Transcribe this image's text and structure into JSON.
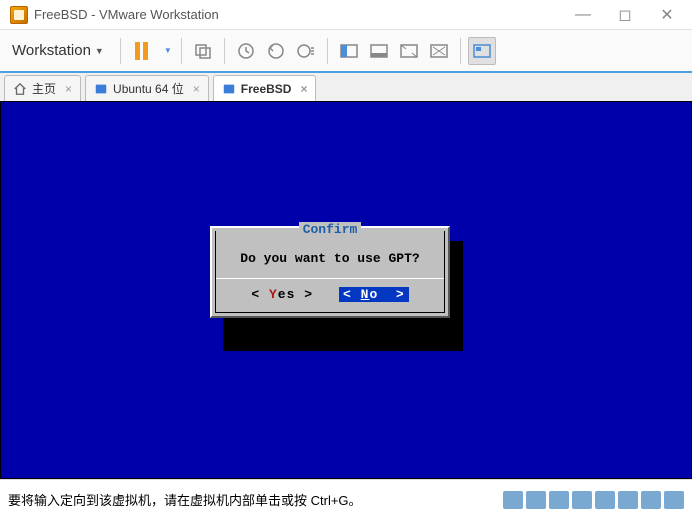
{
  "window": {
    "title": "FreeBSD - VMware Workstation"
  },
  "toolbar": {
    "menu_label": "Workstation"
  },
  "tabs": [
    {
      "label": "主页",
      "icon": "home",
      "active": false
    },
    {
      "label": "Ubuntu 64 位",
      "icon": "cube",
      "active": false
    },
    {
      "label": "FreeBSD",
      "icon": "cube",
      "active": true
    }
  ],
  "dialog": {
    "title": "Confirm",
    "message": "Do you want to use GPT?",
    "buttons": {
      "yes": {
        "bracket_l": "<",
        "y": "Y",
        "rest": "es",
        "bracket_r": ">"
      },
      "no": {
        "bracket_l": "<",
        "n": "N",
        "rest": "o",
        "bracket_r": ">"
      }
    },
    "selected": "no"
  },
  "status": {
    "hint": "要将输入定向到该虚拟机，请在虚拟机内部单击或按 Ctrl+G。"
  }
}
